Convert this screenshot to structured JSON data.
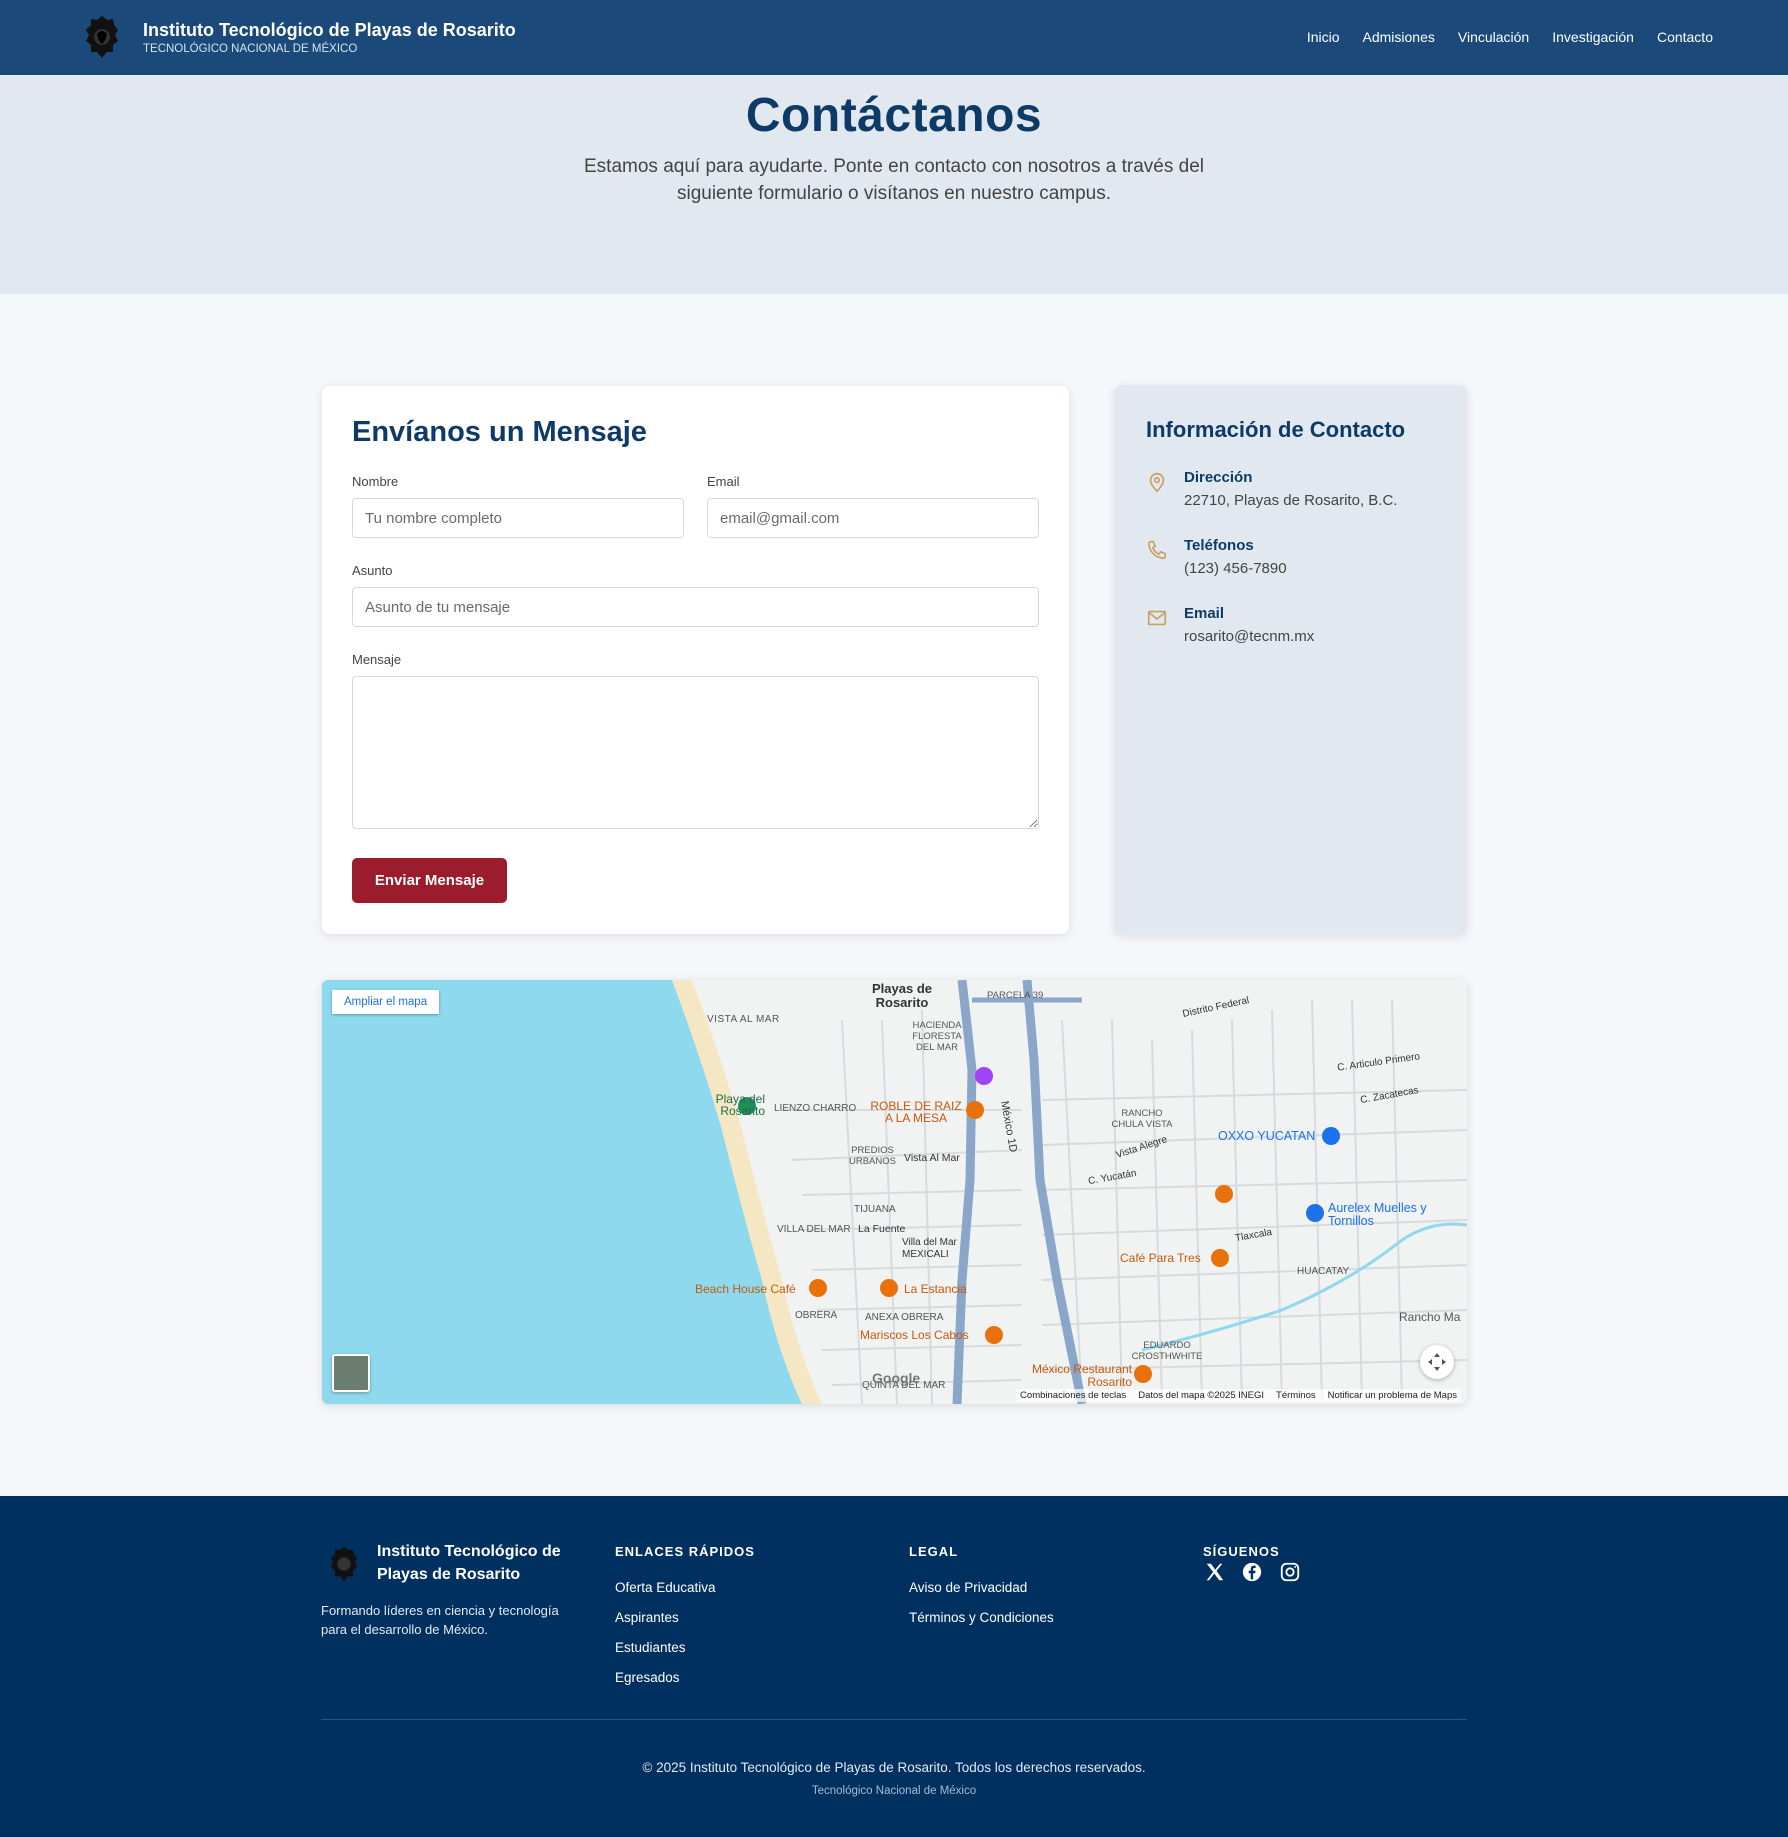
{
  "header": {
    "brand_name": "Instituto Tecnológico de Playas de Rosarito",
    "brand_sub": "TECNOLÓGICO NACIONAL DE MÉXICO",
    "nav": [
      "Inicio",
      "Admisiones",
      "Vinculación",
      "Investigación",
      "Contacto"
    ]
  },
  "hero": {
    "title": "Contáctanos",
    "subtitle": "Estamos aquí para ayudarte. Ponte en contacto con nosotros a través del siguiente formulario o visítanos en nuestro campus."
  },
  "form": {
    "title": "Envíanos un Mensaje",
    "name_label": "Nombre",
    "name_placeholder": "Tu nombre completo",
    "email_label": "Email",
    "email_placeholder": "email@gmail.com",
    "subject_label": "Asunto",
    "subject_placeholder": "Asunto de tu mensaje",
    "message_label": "Mensaje",
    "message_value": "",
    "submit_label": "Enviar Mensaje"
  },
  "contact_info": {
    "title": "Información de Contacto",
    "address_label": "Dirección",
    "address_value": "22710, Playas de Rosarito, B.C.",
    "phone_label": "Teléfonos",
    "phone_value": "(123) 456-7890",
    "email_label": "Email",
    "email_value": "rosarito@tecnm.mx"
  },
  "map": {
    "expand_label": "Ampliar el mapa",
    "google_label": "Google",
    "footer_links": [
      "Combinaciones de teclas",
      "Datos del mapa ©2025 INEGI",
      "Términos",
      "Notificar un problema de Maps"
    ],
    "labels": {
      "city": "Playas de Rosarito",
      "beach": "Playa del Rosarito",
      "vista_al_mar": "VISTA AL MAR",
      "hacienda": "HACIENDA FLORESTA DEL MAR",
      "lienzo": "LIENZO CHARRO",
      "roble": "ROBLE DE RAIZ A LA MESA",
      "predios": "PREDIOS URBANOS",
      "vista_al_mar_st": "Vista Al Mar",
      "tijuana": "TIJUANA",
      "villa": "VILLA DEL MAR",
      "la_fuente": "La Fuente",
      "villa_mexicali": "Villa del Mar MEXICALI",
      "beach_house": "Beach House Café",
      "la_estancia": "La Estancia",
      "obrera": "OBRERA",
      "anexa": "ANEXA OBRERA",
      "mariscos": "Mariscos Los Cabos",
      "quinta": "QUINTA DEL MAR",
      "mexico_rest": "México Restaurant Rosarito",
      "oxxo": "OXXO YUCATAN",
      "aurelex": "Aurelex Muelles y Tornillos",
      "cafe": "Café Para Tres",
      "huacatay": "HUACATAY",
      "rancho": "Rancho Ma",
      "eduardo": "EDUARDO CROSTHWHITE",
      "rancho_chula": "RANCHO CHULA VISTA",
      "parcela": "PARCELA 39",
      "distrito": "Distrito Federal",
      "mexico1d": "México 1D",
      "zacatecas": "C. Zacatecas",
      "articulo": "C. Articulo Primero",
      "yucatan": "C. Yucatán",
      "tlaxcala": "Tlaxcala",
      "vista_alegre": "Vista Alegre"
    }
  },
  "footer": {
    "brand_name": "Instituto Tecnológico de Playas de Rosarito",
    "tagline": "Formando líderes en ciencia y tecnología para el desarrollo de México.",
    "quick_links_heading": "ENLACES RÁPIDOS",
    "quick_links": [
      "Oferta Educativa",
      "Aspirantes",
      "Estudiantes",
      "Egresados"
    ],
    "legal_heading": "LEGAL",
    "legal_links": [
      "Aviso de Privacidad",
      "Términos y Condiciones"
    ],
    "social_heading": "SÍGUENOS",
    "social": [
      "x-icon",
      "facebook-icon",
      "instagram-icon"
    ],
    "copyright": "© 2025 Instituto Tecnológico de Playas de Rosarito. Todos los derechos reservados.",
    "tecnm": "Tecnológico Nacional de México"
  },
  "colors": {
    "primary": "#1b4a7a",
    "navy": "#0e3a68",
    "footer": "#00305f",
    "accent": "#9b1c2c",
    "icon_gold": "#c9a063"
  }
}
